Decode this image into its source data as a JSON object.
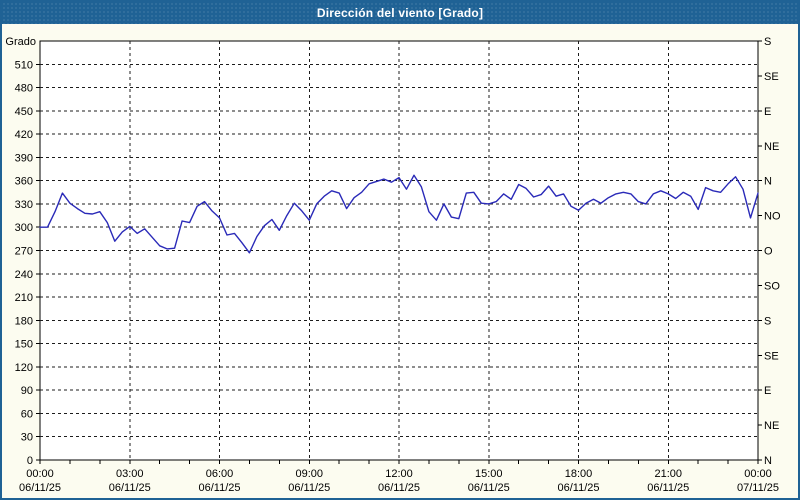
{
  "window": {
    "title_bar_text": "Dirección del viento [Grado]"
  },
  "colors": {
    "title_bar_bg": "#1f6295",
    "title_text": "#ffffff",
    "window_border": "#1f6295",
    "page_bg": "#fcfcf0",
    "plot_bg": "#ffffff",
    "axis_line": "#000000",
    "grid_line": "#1c1c1c",
    "tick_label": "#000000",
    "series_line": "#2a2ab8"
  },
  "chart_data": {
    "type": "line",
    "title": "Dirección del viento [Grado]",
    "ylabel": "Grado",
    "grid": "dashed",
    "legend": "none",
    "y_axis_left": {
      "label": "Grado",
      "min": 0,
      "max": 540,
      "tick_step": 30,
      "tick_labels": [
        "0",
        "30",
        "60",
        "90",
        "120",
        "150",
        "180",
        "210",
        "240",
        "270",
        "300",
        "330",
        "360",
        "390",
        "420",
        "450",
        "480",
        "510"
      ]
    },
    "y_axis_right": {
      "tick_step_degrees": 45,
      "labels_bottom_to_top": [
        "N",
        "NE",
        "E",
        "SE",
        "S",
        "SO",
        "O",
        "NO",
        "N",
        "NE",
        "E",
        "SE",
        "S"
      ]
    },
    "x_axis": {
      "span_hours": 24,
      "major_tick_step_hours": 3,
      "minor_tick_step_hours": 1,
      "ticks": [
        {
          "time": "00:00",
          "date": "06/11/25"
        },
        {
          "time": "03:00",
          "date": "06/11/25"
        },
        {
          "time": "06:00",
          "date": "06/11/25"
        },
        {
          "time": "09:00",
          "date": "06/11/25"
        },
        {
          "time": "12:00",
          "date": "06/11/25"
        },
        {
          "time": "15:00",
          "date": "06/11/25"
        },
        {
          "time": "18:00",
          "date": "06/11/25"
        },
        {
          "time": "21:00",
          "date": "06/11/25"
        },
        {
          "time": "00:00",
          "date": "07/11/25"
        }
      ]
    },
    "series": [
      {
        "name": "Dirección del viento [Grado]",
        "color": "#2a2ab8",
        "x_start_hour": 0,
        "x_step_hours": 0.25,
        "values": [
          300,
          300,
          320,
          344,
          331,
          324,
          318,
          317,
          320,
          306,
          282,
          294,
          301,
          292,
          298,
          287,
          276,
          272,
          273,
          308,
          306,
          327,
          333,
          321,
          312,
          290,
          292,
          280,
          267,
          288,
          302,
          310,
          296,
          315,
          331,
          321,
          309,
          330,
          340,
          347,
          344,
          324,
          338,
          345,
          356,
          359,
          362,
          358,
          364,
          349,
          367,
          352,
          320,
          309,
          330,
          313,
          311,
          344,
          345,
          331,
          330,
          333,
          343,
          336,
          355,
          350,
          339,
          342,
          353,
          340,
          343,
          327,
          322,
          331,
          336,
          331,
          338,
          343,
          345,
          343,
          333,
          330,
          343,
          347,
          343,
          337,
          345,
          340,
          323,
          351,
          347,
          345,
          356,
          365,
          349,
          312,
          344
        ]
      }
    ]
  }
}
